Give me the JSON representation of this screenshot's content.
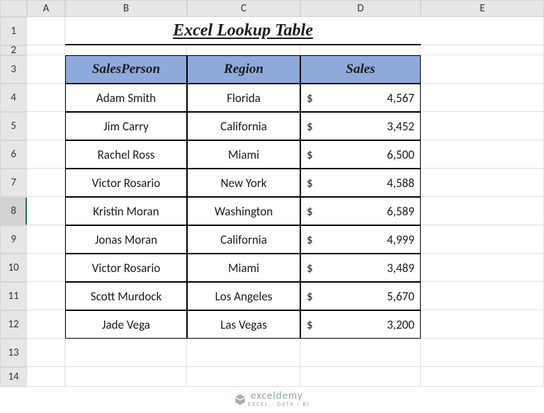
{
  "columns": [
    "A",
    "B",
    "C",
    "D",
    "E"
  ],
  "rows": [
    "1",
    "2",
    "3",
    "4",
    "5",
    "6",
    "7",
    "8",
    "9",
    "10",
    "11",
    "12",
    "13",
    "14"
  ],
  "title": "Excel Lookup Table",
  "headers": {
    "b": "SalesPerson",
    "c": "Region",
    "d": "Sales"
  },
  "data": [
    {
      "person": "Adam Smith",
      "region": "Florida",
      "currency": "$",
      "sales": "4,567"
    },
    {
      "person": "Jim Carry",
      "region": "California",
      "currency": "$",
      "sales": "3,452"
    },
    {
      "person": "Rachel Ross",
      "region": "Miami",
      "currency": "$",
      "sales": "6,500"
    },
    {
      "person": "Victor Rosario",
      "region": "New York",
      "currency": "$",
      "sales": "4,588"
    },
    {
      "person": "Kristin Moran",
      "region": "Washington",
      "currency": "$",
      "sales": "6,589"
    },
    {
      "person": "Jonas Moran",
      "region": "California",
      "currency": "$",
      "sales": "4,999"
    },
    {
      "person": "Victor Rosario",
      "region": "Miami",
      "currency": "$",
      "sales": "3,489"
    },
    {
      "person": "Scott Murdock",
      "region": "Los Angeles",
      "currency": "$",
      "sales": "5,670"
    },
    {
      "person": "Jade Vega",
      "region": "Las Vegas",
      "currency": "$",
      "sales": "3,200"
    }
  ],
  "selected_row": "8",
  "logo": {
    "brand": "exceldemy",
    "tag": "EXCEL · DATA · BI"
  }
}
